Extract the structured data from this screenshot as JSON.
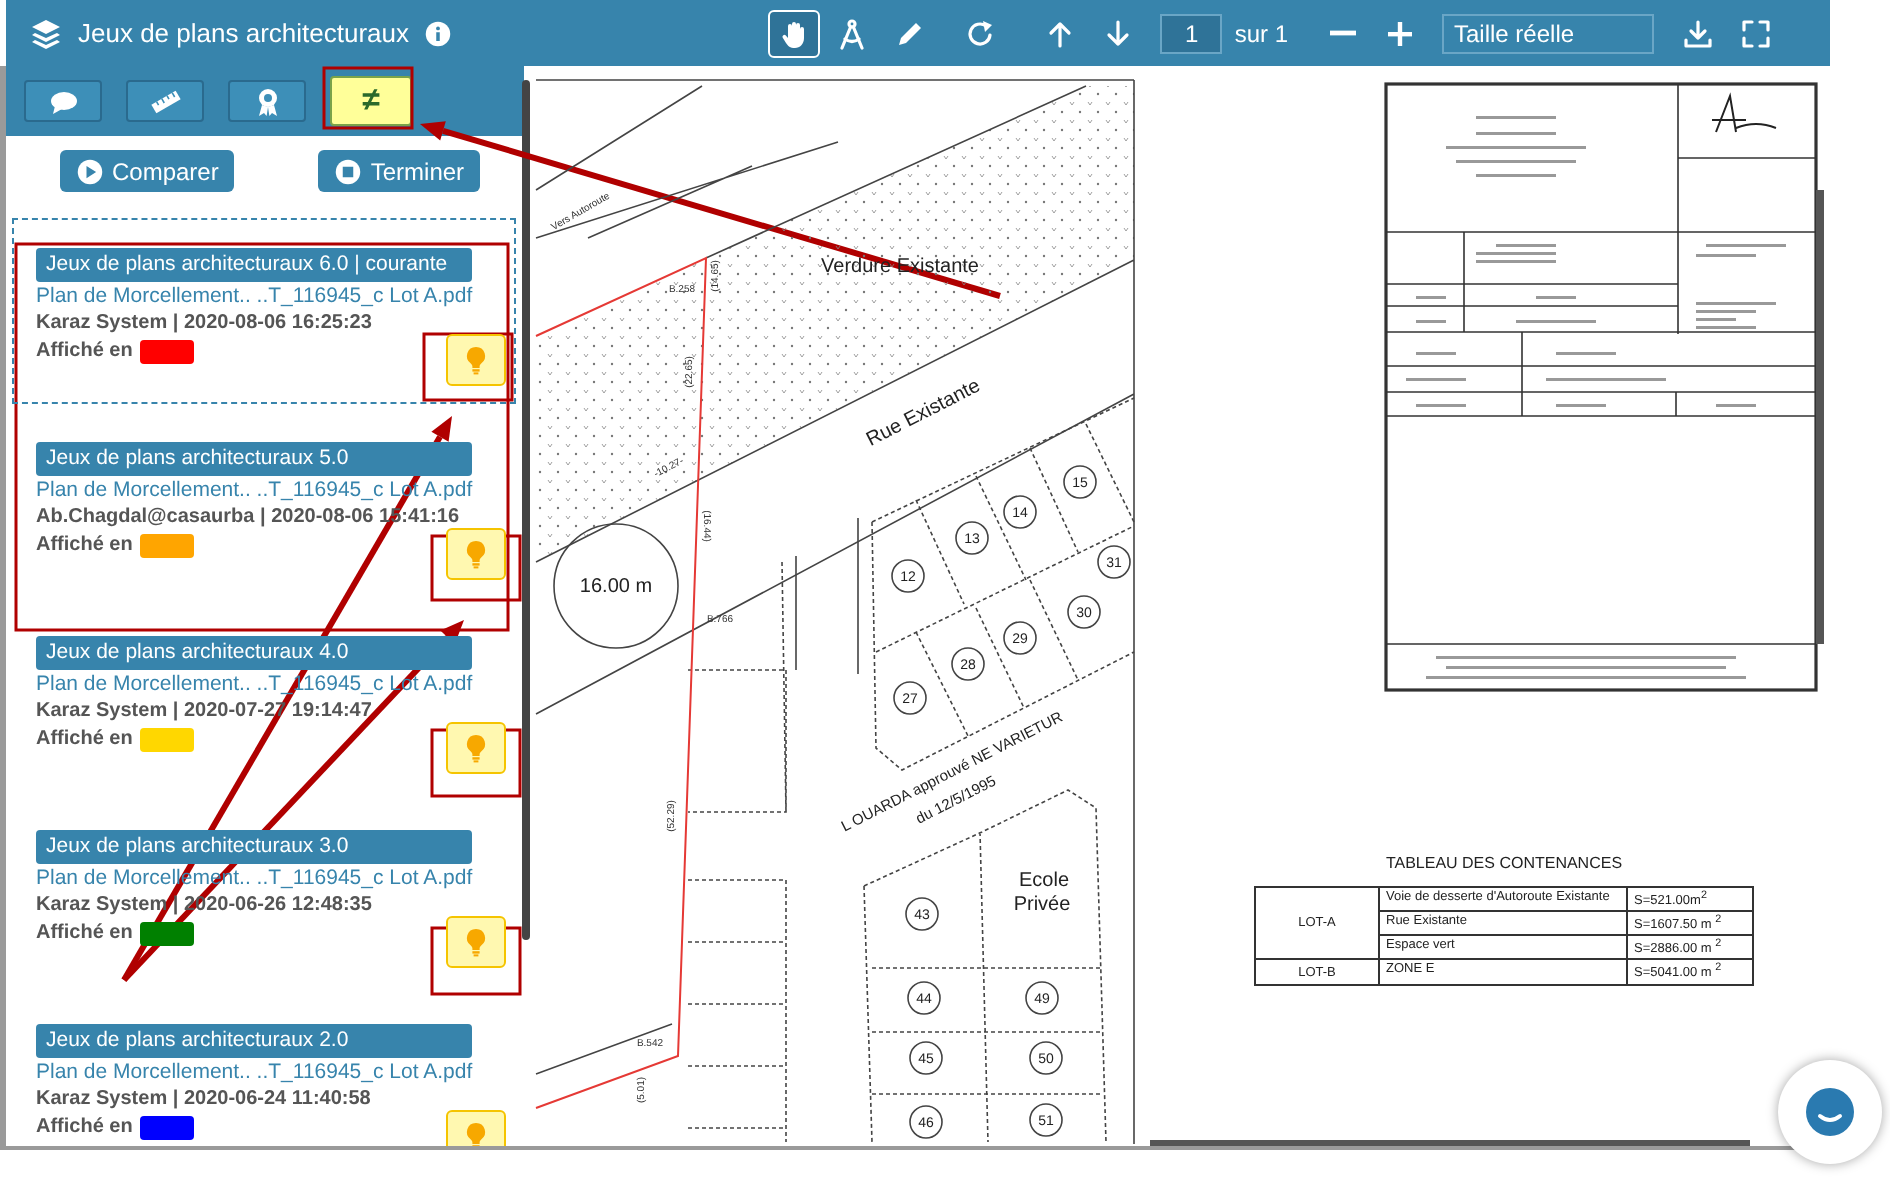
{
  "header": {
    "title": "Jeux de plans architecturaux",
    "tools": [
      {
        "kind": "hand",
        "selected": true
      },
      {
        "kind": "compass",
        "selected": false
      },
      {
        "kind": "pencil",
        "selected": false
      }
    ],
    "page": "1",
    "page_total": "sur 1",
    "zoom": "Taille réelle"
  },
  "panel": {
    "tabs": [
      {
        "kind": "comments",
        "selected": false
      },
      {
        "kind": "measure",
        "selected": false
      },
      {
        "kind": "award",
        "selected": false
      },
      {
        "kind": "compare",
        "label": "≠",
        "selected": true
      }
    ],
    "buttons": [
      {
        "kind": "play",
        "label": "Comparer"
      },
      {
        "kind": "stop",
        "label": "Terminer"
      }
    ],
    "versions": [
      {
        "badge": "Jeux de plans architecturaux 6.0 | courante",
        "file": "Plan de Morcellement.. ..T_116945_c Lot A.pdf",
        "meta": "Karaz System | 2020-08-06 16:25:23",
        "shown": "Affiché en",
        "color": "#ff0000",
        "selected": true
      },
      {
        "badge": "Jeux de plans architecturaux 5.0",
        "file": "Plan de Morcellement.. ..T_116945_c Lot A.pdf",
        "meta": "Ab.Chagdal@casaurba | 2020-08-06 15:41:16",
        "shown": "Affiché en",
        "color": "#ffa500",
        "selected": false
      },
      {
        "badge": "Jeux de plans architecturaux 4.0",
        "file": "Plan de Morcellement.. ..T_116945_c Lot A.pdf",
        "meta": "Karaz System | 2020-07-27 19:14:47",
        "shown": "Affiché en",
        "color": "#ffd700",
        "selected": false
      },
      {
        "badge": "Jeux de plans architecturaux 3.0",
        "file": "Plan de Morcellement.. ..T_116945_c Lot A.pdf",
        "meta": "Karaz System | 2020-06-26 12:48:35",
        "shown": "Affiché en",
        "color": "#008000",
        "selected": false
      },
      {
        "badge": "Jeux de plans architecturaux 2.0",
        "file": "Plan de Morcellement.. ..T_116945_c Lot A.pdf",
        "meta": "Karaz System | 2020-06-24 11:40:58",
        "shown": "Affiché en",
        "color": "#0000ff",
        "selected": false
      }
    ]
  },
  "document": {
    "plan": {
      "labels": [
        {
          "kind": "area",
          "text": "Verdure Existante"
        },
        {
          "kind": "street",
          "text": "Rue Existante"
        },
        {
          "kind": "circle",
          "text": "16.00 m"
        },
        {
          "kind": "note",
          "text": "L  OUARDA approuvé NE VARIETUR"
        },
        {
          "kind": "note",
          "text": "du 12/5/1995"
        },
        {
          "kind": "area",
          "text": "Ecole"
        },
        {
          "kind": "area",
          "text": "Privée"
        },
        {
          "kind": "small",
          "text": "Vers Autoroute"
        },
        {
          "kind": "small",
          "text": "B.258"
        },
        {
          "kind": "small",
          "text": "(14.65)"
        },
        {
          "kind": "small",
          "text": "(22.65)"
        },
        {
          "kind": "small",
          "text": "-10.27-"
        },
        {
          "kind": "small",
          "text": "(16.44)"
        },
        {
          "kind": "small",
          "text": "B.766"
        },
        {
          "kind": "small",
          "text": "(52.29)"
        },
        {
          "kind": "small",
          "text": "B.542"
        },
        {
          "kind": "small",
          "text": "(5.01)"
        }
      ],
      "lots": [
        "15",
        "14",
        "13",
        "12",
        "31",
        "30",
        "29",
        "28",
        "27",
        "43",
        "44",
        "45",
        "46",
        "49",
        "50",
        "51"
      ]
    },
    "contenances": {
      "title": "TABLEAU DES CONTENANCES",
      "groups": [
        {
          "lot": "LOT-A",
          "items": [
            {
              "designation": "Voie de desserte d'Autoroute Existante",
              "area": "S=521.00m$^{2}$"
            },
            {
              "designation": "Rue Existante",
              "area": "S=1607.50 m $^{2}$"
            },
            {
              "designation": "Espace vert",
              "area": "S=2886.00 m $^{2}$"
            }
          ]
        },
        {
          "lot": "LOT-B",
          "items": [
            {
              "designation": "ZONE E",
              "area": "S=5041.00 m $^{2}$"
            }
          ]
        }
      ]
    }
  }
}
